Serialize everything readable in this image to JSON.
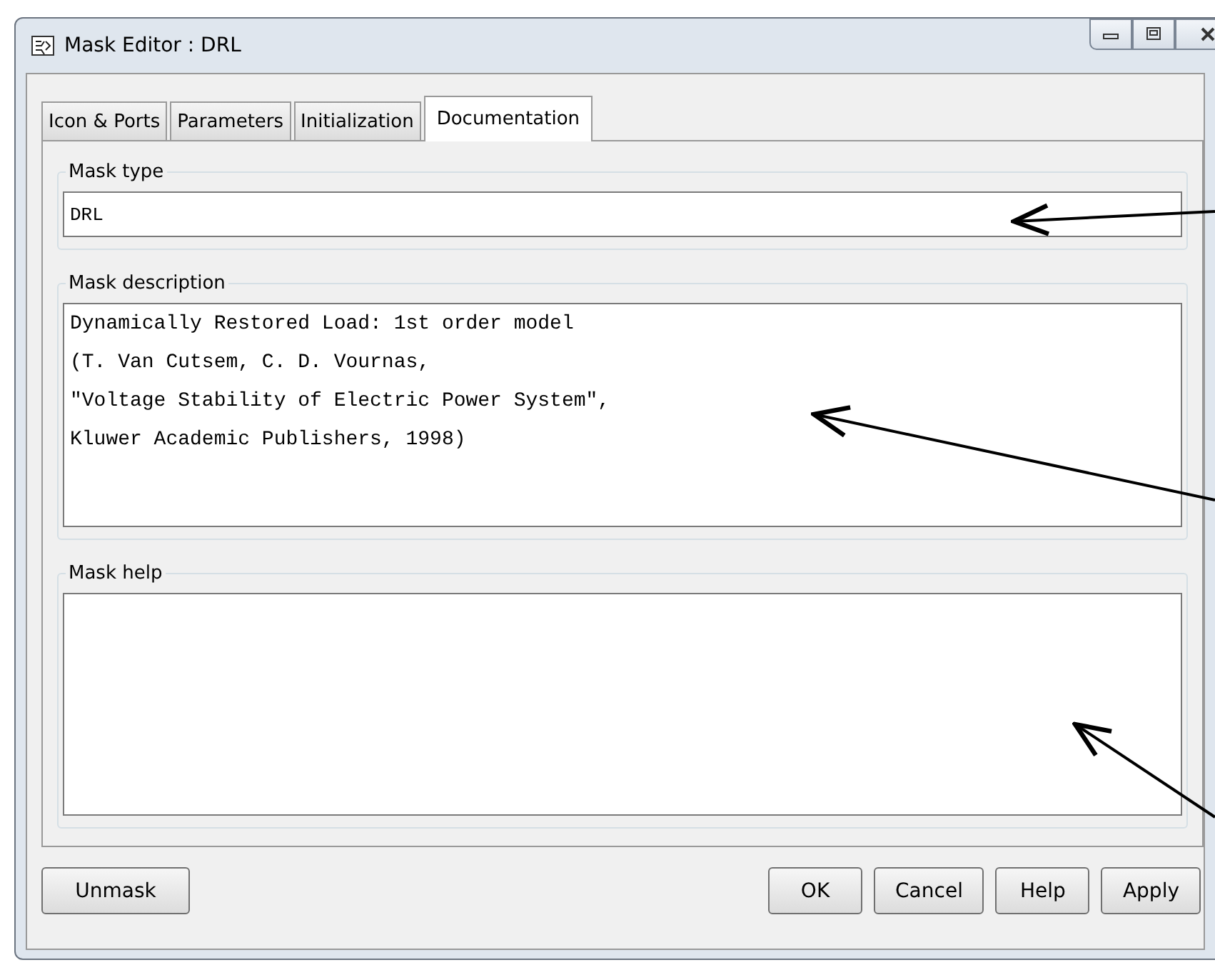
{
  "window": {
    "title": "Mask Editor : DRL"
  },
  "tabs": [
    {
      "label": "Icon & Ports",
      "selected": false
    },
    {
      "label": "Parameters",
      "selected": false
    },
    {
      "label": "Initialization",
      "selected": false
    },
    {
      "label": "Documentation",
      "selected": true
    }
  ],
  "mask_type": {
    "label": "Mask type",
    "value": "DRL"
  },
  "mask_description": {
    "label": "Mask description",
    "lines": [
      "Dynamically Restored Load: 1st order model",
      "(T. Van Cutsem, C. D. Vournas,",
      "\"Voltage Stability of Electric Power System\",",
      "Kluwer Academic Publishers, 1998)"
    ]
  },
  "mask_help": {
    "label": "Mask help"
  },
  "buttons_left": [
    "Unmask"
  ],
  "buttons_right": [
    "OK",
    "Cancel",
    "Help",
    "Apply"
  ]
}
